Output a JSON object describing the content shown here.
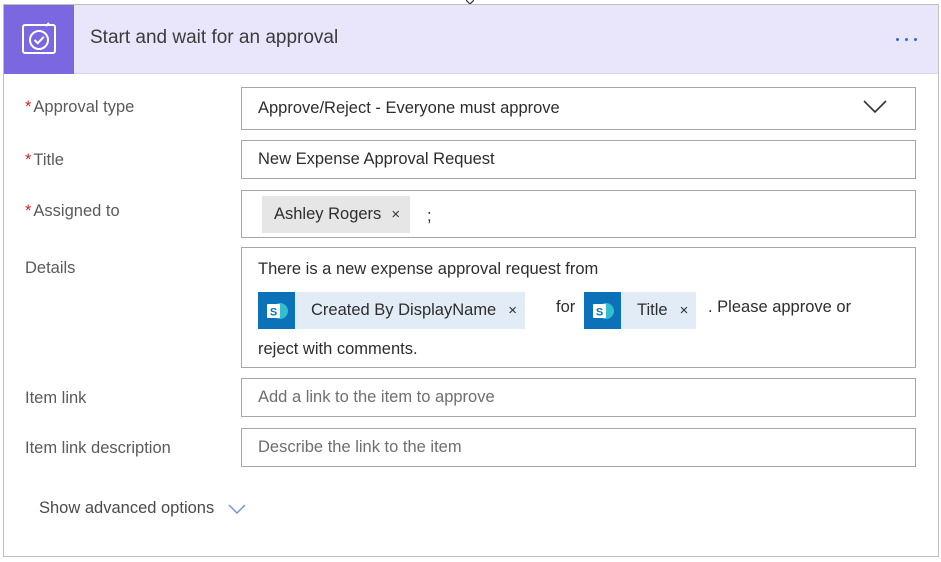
{
  "card": {
    "title": "Start and wait for an approval",
    "more_icon": "ellipsis-icon",
    "header_icon": "approval-icon",
    "accent_color": "#7b67e0",
    "header_bg": "#e9e6fb"
  },
  "fields": {
    "approval_type": {
      "label": "Approval type",
      "required_mark": "*",
      "value": "Approve/Reject - Everyone must approve"
    },
    "title": {
      "label": "Title",
      "required_mark": "*",
      "value": "New Expense Approval Request"
    },
    "assigned_to": {
      "label": "Assigned to",
      "required_mark": "*",
      "token": "Ashley Rogers",
      "remove_glyph": "×",
      "separator": ";"
    },
    "details": {
      "label": "Details",
      "line1": "There is a new expense approval request from",
      "token1": "Created By DisplayName",
      "between": "for",
      "token2": "Title",
      "after": ". Please approve or",
      "line3": "reject with comments.",
      "remove_glyph": "×"
    },
    "item_link": {
      "label": "Item link",
      "placeholder": "Add a link to the item to approve"
    },
    "item_link_description": {
      "label": "Item link description",
      "placeholder": "Describe the link to the item"
    }
  },
  "advanced": {
    "label": "Show advanced options"
  }
}
